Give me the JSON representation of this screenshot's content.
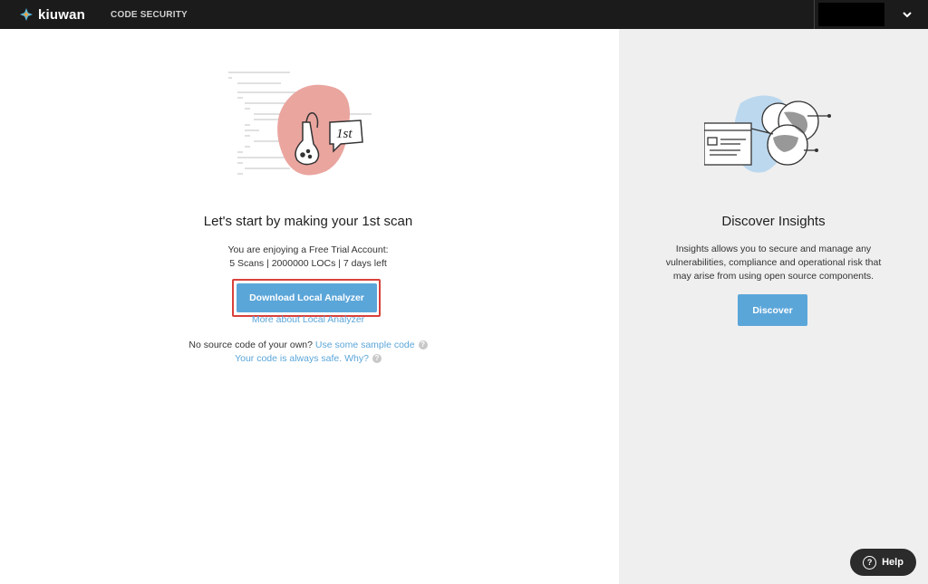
{
  "header": {
    "brand": "kiuwan",
    "nav_item": "CODE SECURITY"
  },
  "scan_section": {
    "illustration_badge": "1st",
    "title": "Let's start by making your 1st scan",
    "trial_line1": "You are enjoying a Free Trial Account:",
    "trial_line2": "5 Scans | 2000000 LOCs | 7 days left",
    "download_button": "Download Local Analyzer",
    "more_link": "More about Local Analyzer",
    "no_source_text": "No source code of your own?",
    "sample_link": "Use some sample code",
    "safe_link": "Your code is always safe. Why?"
  },
  "insights_section": {
    "title": "Discover Insights",
    "description": "Insights allows you to secure and manage any vulnerabilities, compliance and operational risk that may arise from using open source components.",
    "discover_button": "Discover"
  },
  "help_button": {
    "label": "Help"
  },
  "colors": {
    "topbar": "#1b1b1b",
    "accent": "#5ba6d9",
    "right_panel": "#efefef",
    "highlight": "#d9413b"
  }
}
